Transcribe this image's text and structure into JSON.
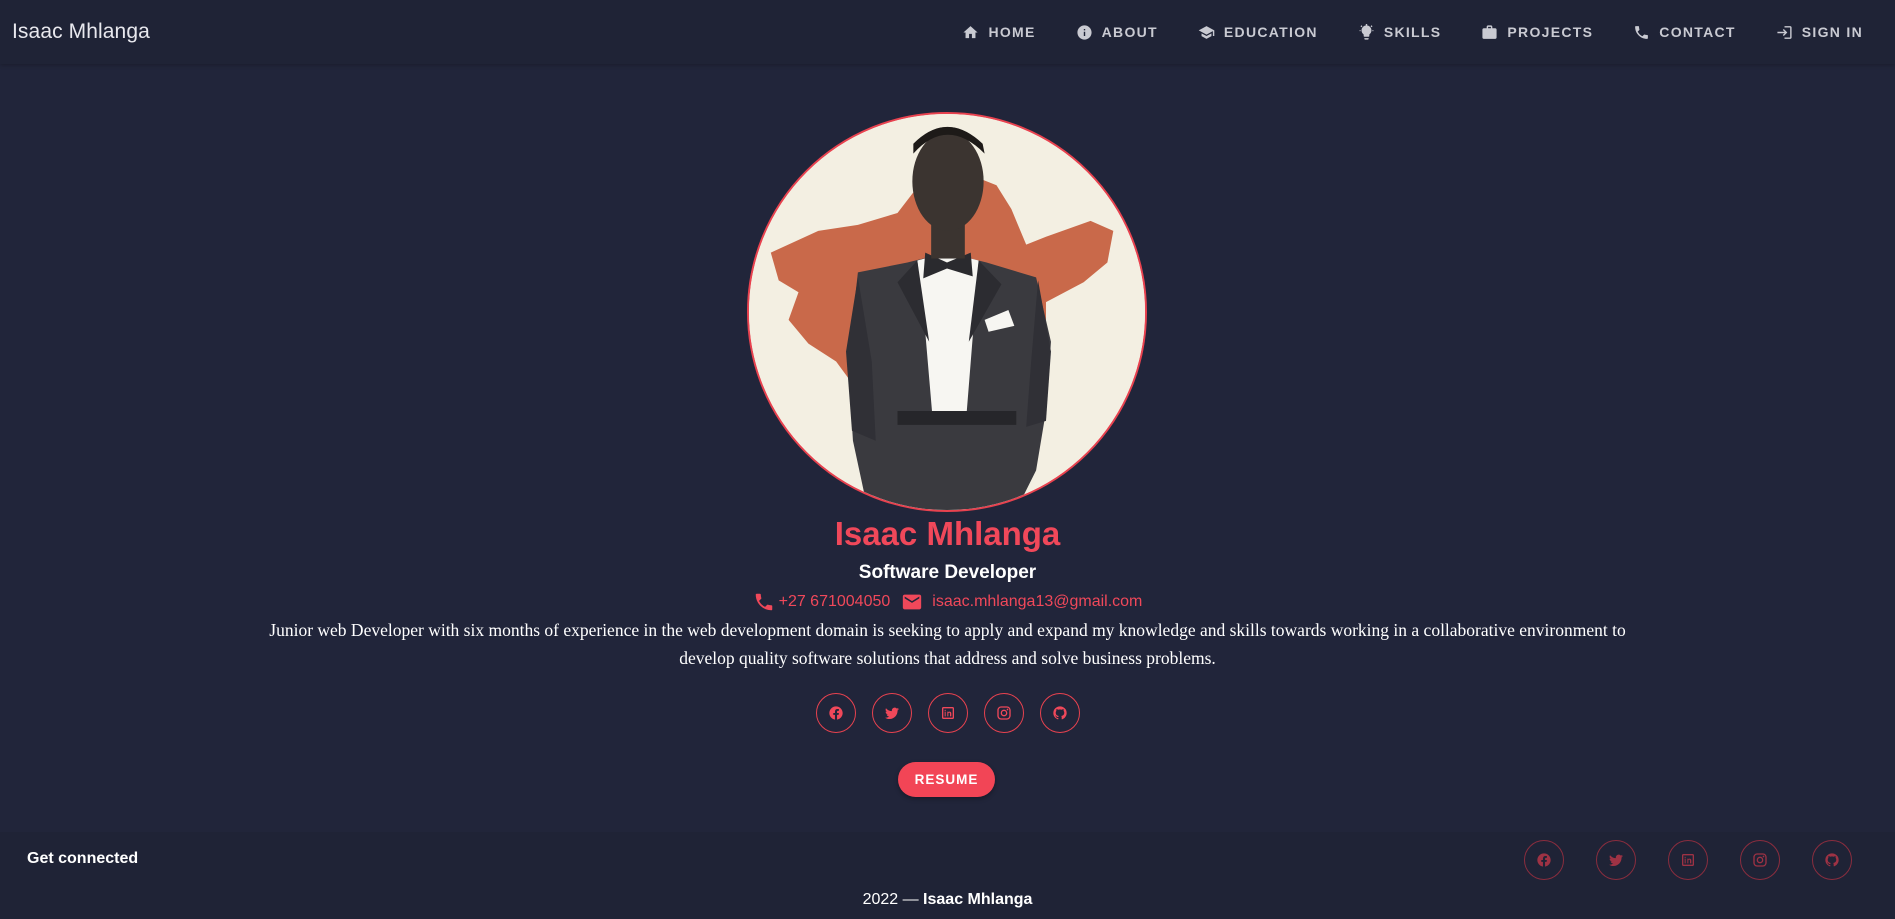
{
  "navbar": {
    "brand": "Isaac Mhlanga",
    "items": [
      {
        "label": "HOME",
        "icon": "home-icon"
      },
      {
        "label": "ABOUT",
        "icon": "info-icon"
      },
      {
        "label": "EDUCATION",
        "icon": "graduation-cap-icon"
      },
      {
        "label": "SKILLS",
        "icon": "lightbulb-icon"
      },
      {
        "label": "PROJECTS",
        "icon": "briefcase-icon"
      },
      {
        "label": "CONTACT",
        "icon": "phone-icon"
      },
      {
        "label": "SIGN IN",
        "icon": "sign-in-icon"
      }
    ]
  },
  "profile": {
    "name": "Isaac Mhlanga",
    "role": "Software Developer",
    "phone": "+27 671004050",
    "email": "isaac.mhlanga13@gmail.com",
    "bio": "Junior web Developer with six months of experience in the web development domain is seeking to apply and expand my knowledge and skills towards working in a collaborative environment to develop quality software solutions that address and solve business problems.",
    "resume_label": "RESUME"
  },
  "socials": [
    "facebook-icon",
    "twitter-icon",
    "linkedin-icon",
    "instagram-icon",
    "github-icon"
  ],
  "footer": {
    "get_connected": "Get connected",
    "year": "2022 — ",
    "owner": "Isaac Mhlanga"
  },
  "colors": {
    "background": "#21253a",
    "navbar": "#1f2336",
    "accent": "#f0485a"
  }
}
